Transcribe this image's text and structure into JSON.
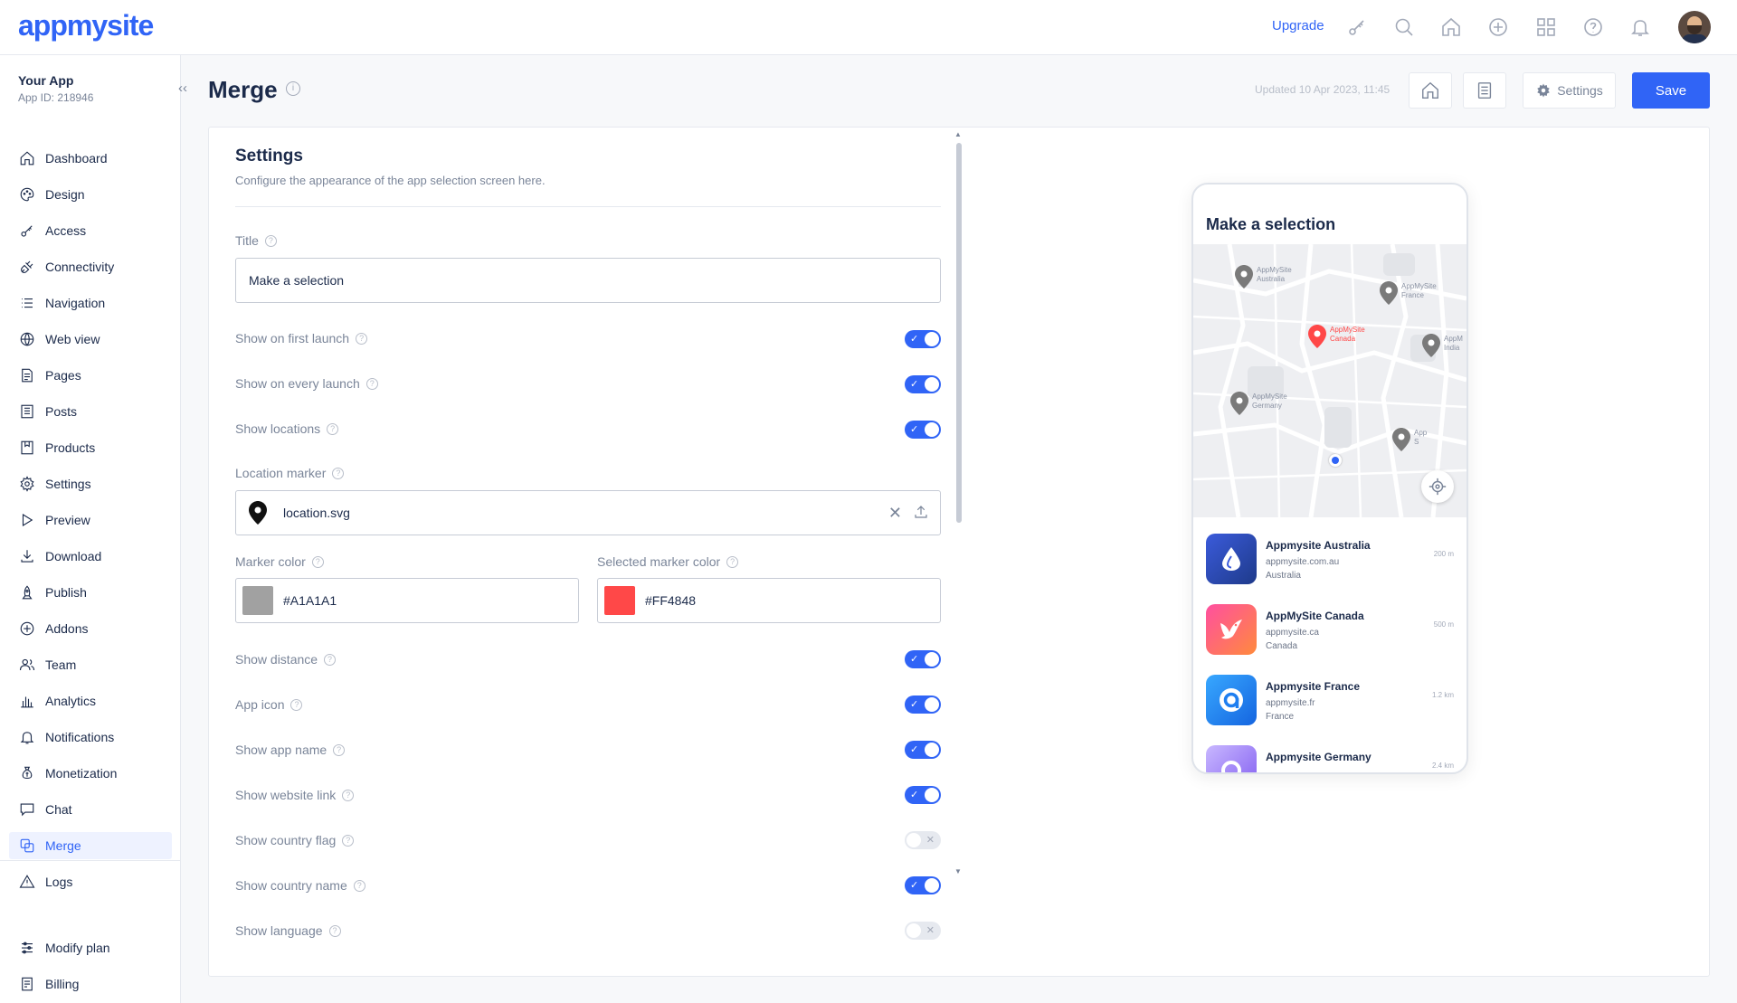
{
  "brand": {
    "logo_text": "appmysite"
  },
  "topbar": {
    "upgrade_label": "Upgrade",
    "icons": [
      "access-icon",
      "search-icon",
      "home-icon",
      "add-icon",
      "apps-grid-icon",
      "help-icon",
      "notification-bell-icon"
    ]
  },
  "sidebar": {
    "app_name": "Your App",
    "app_id": "App ID: 218946",
    "collapse_glyph": "‹‹",
    "items": [
      {
        "label": "Dashboard",
        "icon": "home-icon"
      },
      {
        "label": "Design",
        "icon": "palette-icon"
      },
      {
        "label": "Access",
        "icon": "key-icon"
      },
      {
        "label": "Connectivity",
        "icon": "plug-icon"
      },
      {
        "label": "Navigation",
        "icon": "list-icon"
      },
      {
        "label": "Web view",
        "icon": "globe-icon"
      },
      {
        "label": "Pages",
        "icon": "page-icon"
      },
      {
        "label": "Posts",
        "icon": "posts-icon"
      },
      {
        "label": "Products",
        "icon": "products-icon"
      },
      {
        "label": "Settings",
        "icon": "gear-icon"
      },
      {
        "label": "Preview",
        "icon": "play-icon"
      },
      {
        "label": "Download",
        "icon": "download-icon"
      },
      {
        "label": "Publish",
        "icon": "publish-icon"
      },
      {
        "label": "Addons",
        "icon": "plus-circle-icon"
      },
      {
        "label": "Team",
        "icon": "team-icon"
      },
      {
        "label": "Analytics",
        "icon": "bar-chart-icon"
      },
      {
        "label": "Notifications",
        "icon": "bell-icon"
      },
      {
        "label": "Monetization",
        "icon": "money-icon"
      },
      {
        "label": "Chat",
        "icon": "chat-icon"
      },
      {
        "label": "Merge",
        "icon": "merge-icon",
        "active": true
      },
      {
        "label": "Logs",
        "icon": "warning-icon"
      }
    ],
    "bottom_items": [
      {
        "label": "Modify plan",
        "icon": "sliders-icon"
      },
      {
        "label": "Billing",
        "icon": "billing-icon"
      }
    ]
  },
  "header": {
    "title": "Merge",
    "updated": "Updated 10 Apr 2023, 11:45",
    "settings_label": "Settings",
    "save_label": "Save"
  },
  "settings": {
    "title": "Settings",
    "subtitle": "Configure the appearance of the app selection screen here.",
    "title_field": {
      "label": "Title",
      "value": "Make a selection"
    },
    "show_first_launch": {
      "label": "Show on first launch",
      "on": true
    },
    "show_every_launch": {
      "label": "Show on every launch",
      "on": true
    },
    "show_locations": {
      "label": "Show locations",
      "on": true
    },
    "location_marker": {
      "label": "Location marker",
      "file": "location.svg"
    },
    "marker_color": {
      "label": "Marker color",
      "value": "#A1A1A1",
      "swatch": "#A1A1A1"
    },
    "selected_marker_color": {
      "label": "Selected marker color",
      "value": "#FF4848",
      "swatch": "#FF4848"
    },
    "show_distance": {
      "label": "Show distance",
      "on": true
    },
    "app_icon": {
      "label": "App icon",
      "on": true
    },
    "show_app_name": {
      "label": "Show app name",
      "on": true
    },
    "show_website_link": {
      "label": "Show website link",
      "on": true
    },
    "show_country_flag": {
      "label": "Show country flag",
      "on": false
    },
    "show_country_name": {
      "label": "Show country name",
      "on": true
    },
    "show_language": {
      "label": "Show language",
      "on": false
    }
  },
  "preview": {
    "title": "Make a selection",
    "pins": [
      {
        "line1": "AppMySite",
        "line2": "Australia",
        "color": "#7a7a7a"
      },
      {
        "line1": "AppMySite",
        "line2": "France",
        "color": "#7a7a7a"
      },
      {
        "line1": "AppMySite",
        "line2": "Canada",
        "color": "#FF4848"
      },
      {
        "line1": "AppM",
        "line2": "India",
        "color": "#7a7a7a"
      },
      {
        "line1": "AppMySite",
        "line2": "Germany",
        "color": "#7a7a7a"
      },
      {
        "line1": "App",
        "line2": "S",
        "color": "#7a7a7a"
      }
    ],
    "apps": [
      {
        "name": "Appmysite Australia",
        "site": "appmysite.com.au",
        "country": "Australia",
        "distance": "200 m"
      },
      {
        "name": "AppMySite Canada",
        "site": "appmysite.ca",
        "country": "Canada",
        "distance": "500 m"
      },
      {
        "name": "Appmysite France",
        "site": "appmysite.fr",
        "country": "France",
        "distance": "1.2 km"
      },
      {
        "name": "Appmysite Germany",
        "site": "",
        "country": "",
        "distance": "2.4 km"
      }
    ]
  },
  "colors": {
    "accent": "#3064f6",
    "text": "#1b2a4a",
    "muted": "#7a8599"
  }
}
